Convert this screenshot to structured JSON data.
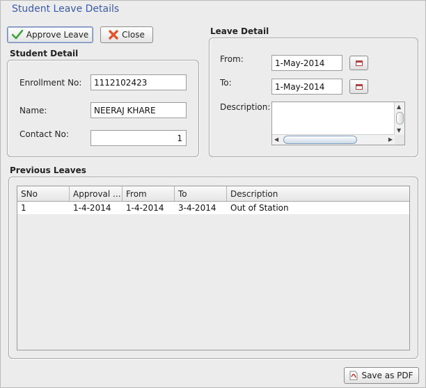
{
  "window": {
    "title": "Student Leave Details"
  },
  "toolbar": {
    "approve_label": "Approve Leave",
    "close_label": "Close"
  },
  "student": {
    "section_title": "Student Detail",
    "enrollment_label": "Enrollment No:",
    "enrollment_value": "1112102423",
    "name_label": "Name:",
    "name_value": "NEERAJ KHARE",
    "contact_label": "Contact No:",
    "contact_value": "1"
  },
  "leave": {
    "section_title": "Leave Detail",
    "from_label": "From:",
    "from_value": "1-May-2014",
    "to_label": "To:",
    "to_value": "1-May-2014",
    "description_label": "Description:",
    "description_value": ""
  },
  "previous": {
    "section_title": "Previous Leaves",
    "columns": [
      "SNo",
      "Approval ...",
      "From",
      "To",
      "Description"
    ],
    "rows": [
      [
        "1",
        "1-4-2014",
        "1-4-2014",
        "3-4-2014",
        "Out of Station"
      ]
    ]
  },
  "footer": {
    "save_pdf_label": "Save as PDF"
  },
  "icons": {
    "approve": "check-icon",
    "close": "close-x-icon",
    "calendar": "calendar-icon",
    "pdf": "pdf-icon"
  },
  "colors": {
    "title": "#3b5ba8",
    "check": "#3aa33a",
    "close": "#e0562b"
  }
}
